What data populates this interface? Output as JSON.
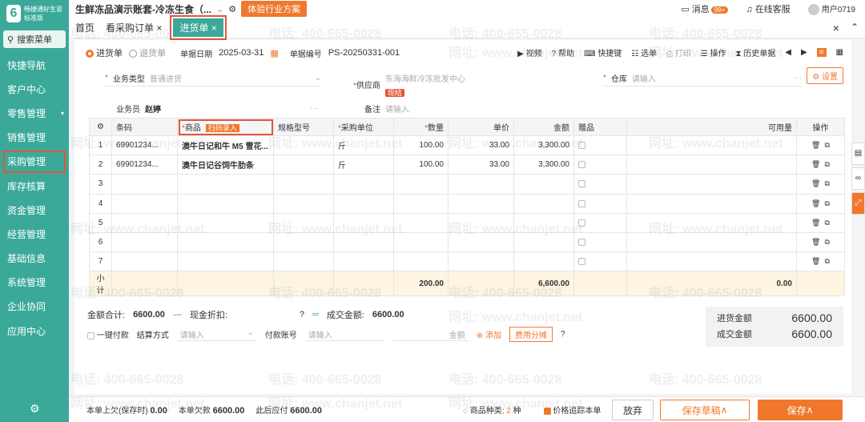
{
  "sidebar": {
    "logo_text": "畅捷通好生意",
    "edition": "标准版",
    "search_label": "搜索菜单",
    "items": [
      {
        "label": "快捷导航"
      },
      {
        "label": "客户中心"
      },
      {
        "label": "零售管理",
        "caret": "▾"
      },
      {
        "label": "销售管理"
      },
      {
        "label": "采购管理"
      },
      {
        "label": "库存核算"
      },
      {
        "label": "资金管理"
      },
      {
        "label": "经营管理"
      },
      {
        "label": "基础信息"
      },
      {
        "label": "系统管理"
      },
      {
        "label": "企业协同"
      },
      {
        "label": "应用中心"
      }
    ]
  },
  "topbar": {
    "account": "生鲜冻品演示账套-冷冻生食（...",
    "industry_button": "体验行业方案",
    "messages": "消息",
    "message_badge": "99+",
    "service": "在线客服",
    "user": "用户0719"
  },
  "tabs": {
    "home": "首页",
    "view_po": "看采购订单",
    "active": "进货单"
  },
  "form": {
    "type_in": "进货单",
    "type_return": "退货单",
    "date_label": "单据日期",
    "date_value": "2025-03-31",
    "no_label": "单据编号",
    "no_value": "PS-20250331-001",
    "toolbar": [
      "视频",
      "帮助",
      "快捷键",
      "选单",
      "打印",
      "操作",
      "历史单据"
    ],
    "biz_type_label": "业务类型",
    "biz_type_value": "普通进货",
    "supplier_label": "供应商",
    "supplier_value": "东海海鲜冷冻批发中心",
    "settle_stamp": "现结",
    "warehouse_label": "仓库",
    "warehouse_placeholder": "请输入",
    "settings_button": "设置",
    "staff_label": "业务员",
    "staff_value": "赵婷",
    "remark_label": "备注",
    "remark_placeholder": "请输入"
  },
  "grid": {
    "headers": [
      "条码",
      "商品",
      "规格型号",
      "采购单位",
      "数量",
      "单价",
      "金额",
      "赠品",
      "可用量",
      "操作"
    ],
    "scan_button": "扫码录入",
    "rows": [
      {
        "no": "1",
        "barcode": "69901234...",
        "product": "澳牛日记和牛 M5 雪花...",
        "spec": "",
        "unit": "斤",
        "qty": "100.00",
        "price": "33.00",
        "amount": "3,300.00"
      },
      {
        "no": "2",
        "barcode": "69901234...",
        "product": "澳牛日记谷饲牛肋条",
        "spec": "",
        "unit": "斤",
        "qty": "100.00",
        "price": "33.00",
        "amount": "3,300.00"
      },
      {
        "no": "3"
      },
      {
        "no": "4"
      },
      {
        "no": "5"
      },
      {
        "no": "6"
      },
      {
        "no": "7"
      }
    ],
    "subtotal_label": "小计",
    "subtotal_qty": "200.00",
    "subtotal_amount": "6,600.00",
    "subtotal_avail": "0.00"
  },
  "summary": {
    "total_label": "金额合计:",
    "total_value": "6600.00",
    "discount_label": "现金折扣:",
    "deal_label": "成交金额:",
    "deal_value": "6600.00",
    "one_click_pay": "一键付款",
    "settle_method": "结算方式",
    "settle_placeholder": "请输入",
    "pay_account": "付款账号",
    "pay_account_placeholder": "请输入",
    "amount_placeholder": "金额",
    "add": "添加",
    "fee_button": "费用分摊",
    "purchase_total_label": "进货金额",
    "purchase_total": "6600.00",
    "deal_total_label": "成交金额",
    "deal_total": "6600.00"
  },
  "footer": {
    "prev_owed_label": "本单上欠(保存时)",
    "prev_owed": "0.00",
    "this_owed_label": "本单欠款",
    "this_owed": "6600.00",
    "after_label": "此后应付",
    "after": "6600.00",
    "kinds_label": "商品种类:",
    "kinds_value": "2",
    "kinds_unit": "种",
    "trace_label": "价格追踪本单",
    "abandon": "放弃",
    "save_draft": "保存草稿",
    "save": "保存"
  },
  "watermark": {
    "phone": "电话: 400-665-0028",
    "site": "网址: www.chanjet.net"
  },
  "colors": {
    "brand": "#3aa99a",
    "accent": "#f0782d",
    "highlight": "#e4553a"
  }
}
